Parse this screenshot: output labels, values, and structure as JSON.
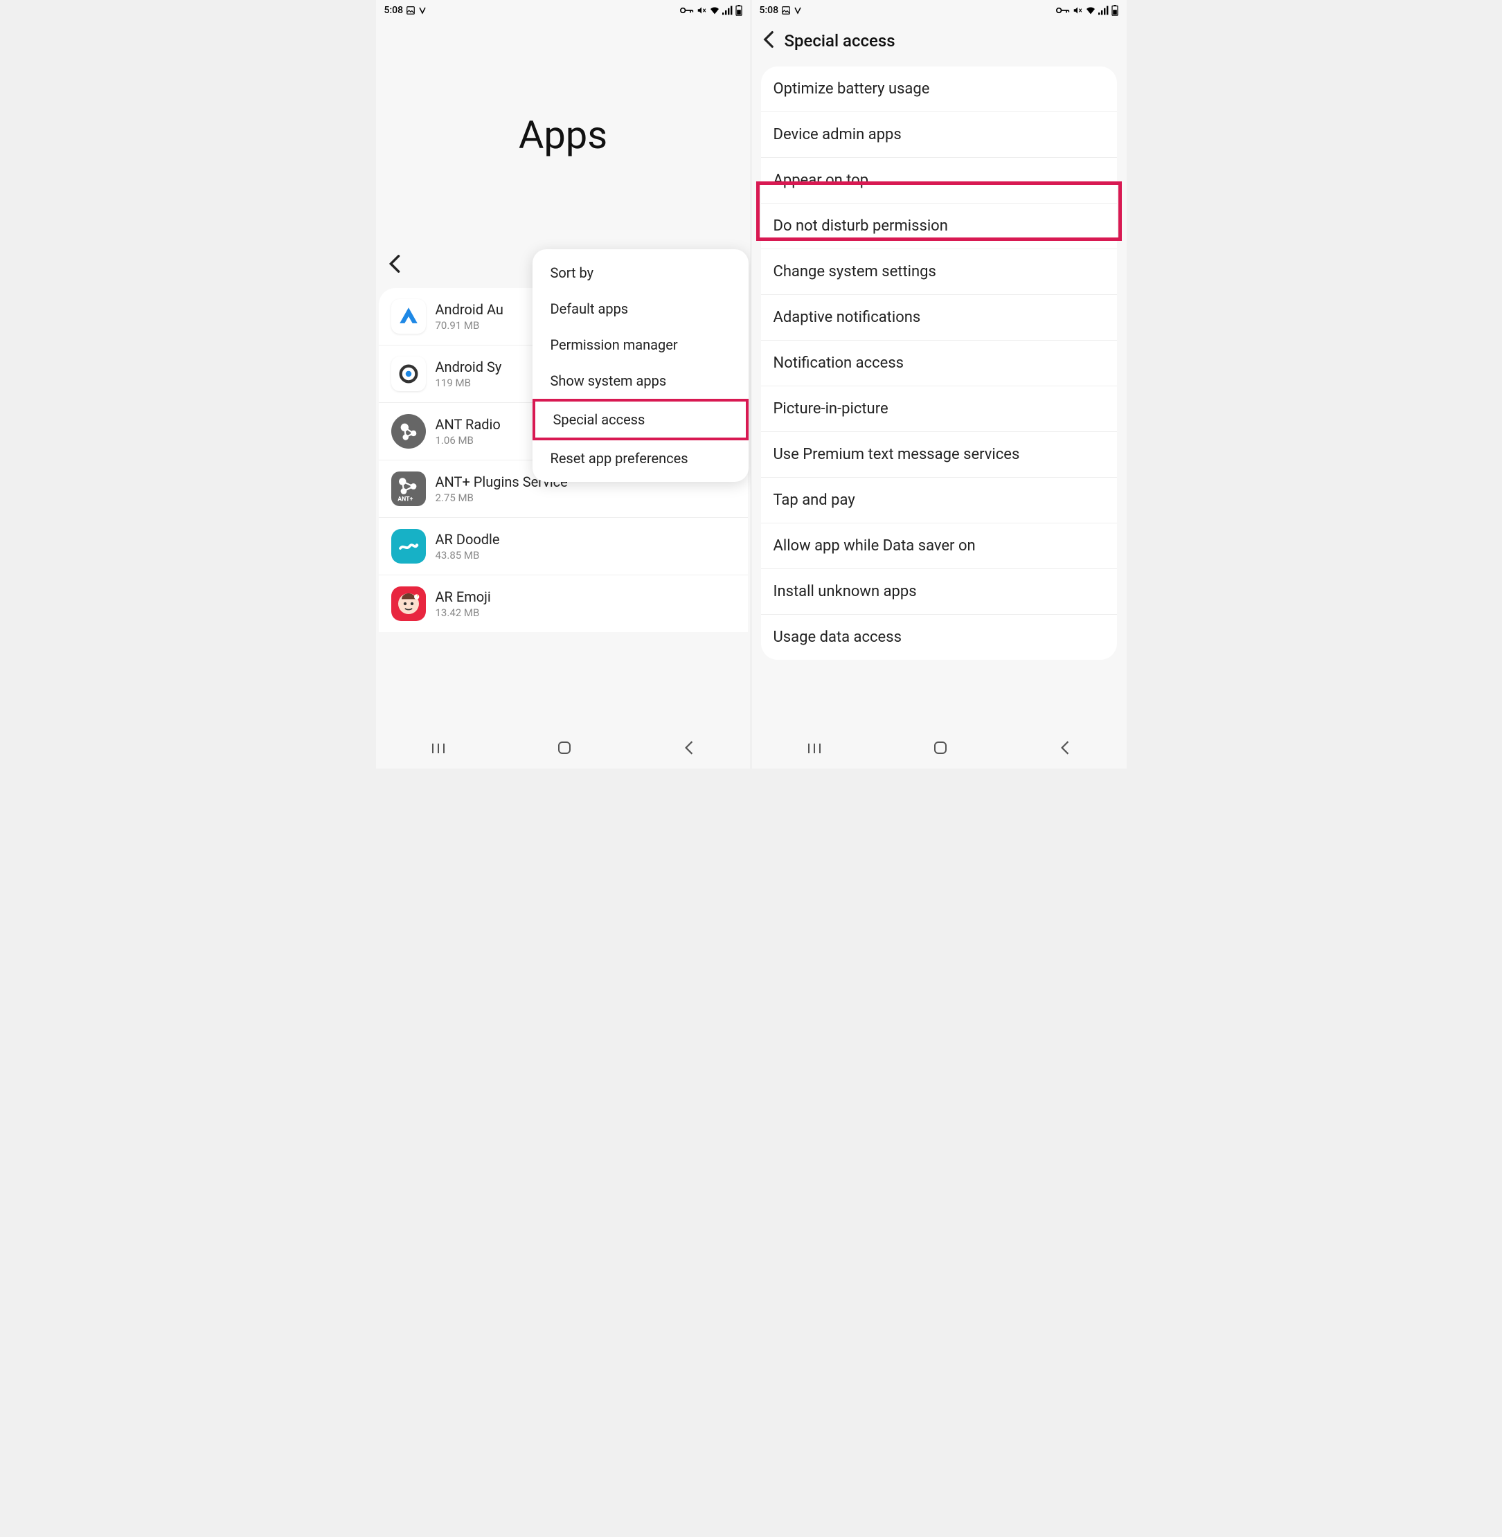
{
  "status": {
    "time": "5:08",
    "icons_right": [
      "vpn-key-icon",
      "volume-mute-icon",
      "wifi-icon",
      "signal-icon",
      "battery-icon"
    ]
  },
  "screen1": {
    "title": "Apps",
    "apps": [
      {
        "name": "Android Au",
        "size": "70.91 MB"
      },
      {
        "name": "Android Sy",
        "size": "119 MB"
      },
      {
        "name": "ANT Radio",
        "size": "1.06 MB"
      },
      {
        "name": "ANT+ Plugins Service",
        "size": "2.75 MB"
      },
      {
        "name": "AR Doodle",
        "size": "43.85 MB"
      },
      {
        "name": "AR Emoji",
        "size": "13.42 MB"
      }
    ],
    "popup": {
      "items": [
        "Sort by",
        "Default apps",
        "Permission manager",
        "Show system apps",
        "Special access",
        "Reset app preferences"
      ],
      "highlighted_index": 4
    }
  },
  "screen2": {
    "title": "Special access",
    "items": [
      "Optimize battery usage",
      "Device admin apps",
      "Appear on top",
      "Do not disturb permission",
      "Change system settings",
      "Adaptive notifications",
      "Notification access",
      "Picture-in-picture",
      "Use Premium text message services",
      "Tap and pay",
      "Allow app while Data saver on",
      "Install unknown apps",
      "Usage data access"
    ],
    "highlighted_index": 2
  }
}
